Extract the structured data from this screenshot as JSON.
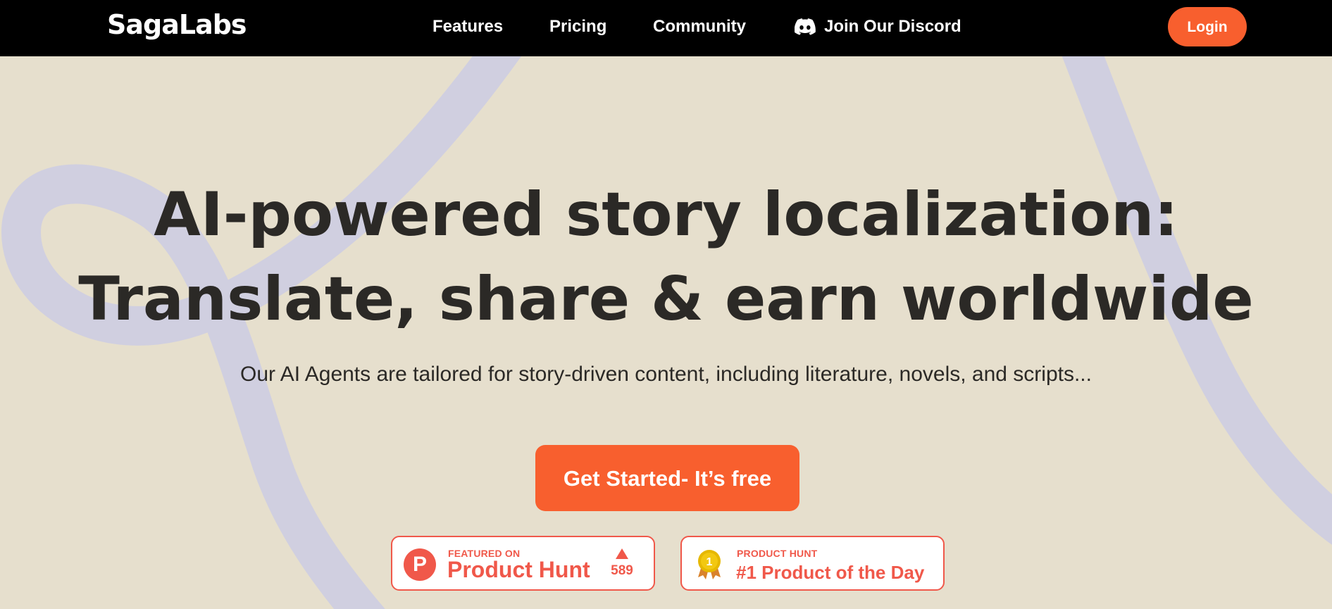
{
  "colors": {
    "navbar_bg": "#000000",
    "page_bg": "#e6dfcd",
    "accent": "#f85f2e",
    "badge_accent": "#f0584a",
    "heading_text": "#2b2926",
    "curve": "#d0cfe0",
    "medal_gold": "#e6b800"
  },
  "header": {
    "logo": "SagaLabs",
    "nav": {
      "features": "Features",
      "pricing": "Pricing",
      "community": "Community",
      "discord": "Join Our Discord"
    },
    "discord_icon": "discord-icon",
    "login_label": "Login"
  },
  "hero": {
    "title_line1": "AI-powered story localization:",
    "title_line2": "Translate, share & earn worldwide",
    "subtitle": "Our AI Agents are tailored for story-driven content, including literature, novels, and scripts...",
    "cta_label": "Get Started- It’s free"
  },
  "badges": {
    "featured": {
      "icon": "product-hunt-logo",
      "logo_letter": "P",
      "small": "FEATURED ON",
      "big": "Product Hunt",
      "upvote_icon": "upvote-arrow-icon",
      "upvotes": "589"
    },
    "product_of_day": {
      "icon": "medal-icon",
      "medal_number": "1",
      "small": "PRODUCT HUNT",
      "big": "#1 Product of the Day"
    }
  }
}
